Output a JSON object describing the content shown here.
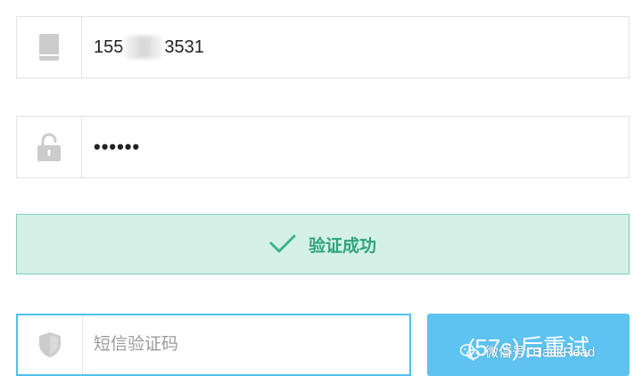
{
  "phone": {
    "value_start": "155",
    "value_end": "3531",
    "icon": "phone-icon"
  },
  "password": {
    "value": "••••••",
    "icon": "lock-icon"
  },
  "verification": {
    "status_text": "验证成功",
    "icon": "checkmark-icon",
    "accent": "#2fa37d",
    "background": "#d5f1e7"
  },
  "sms_code": {
    "placeholder": "短信验证码",
    "icon": "shield-icon"
  },
  "resend": {
    "label": "(57s)后重试",
    "color": "#5ec3f0"
  },
  "watermark": {
    "text": "微信号: HackRead",
    "icon": "wechat-icon"
  }
}
